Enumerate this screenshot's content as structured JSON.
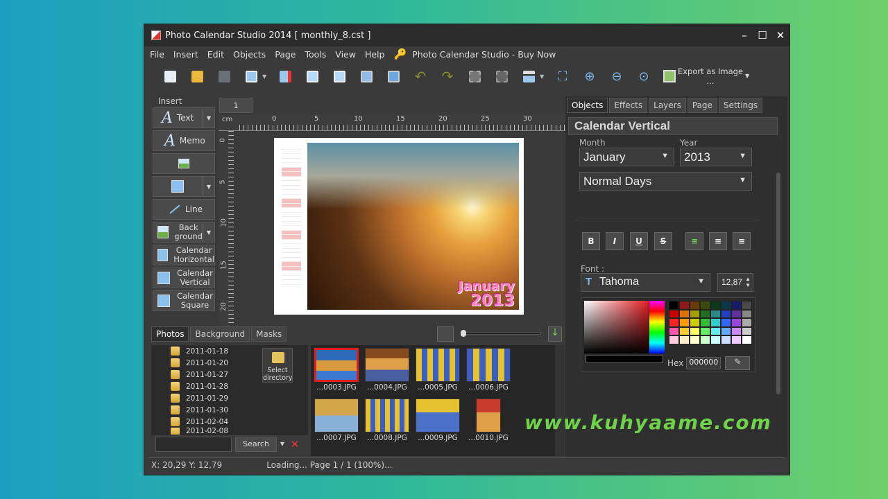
{
  "window": {
    "title": "Photo Calendar Studio 2014 [ monthly_8.cst ]"
  },
  "menu": {
    "items": [
      "File",
      "Insert",
      "Edit",
      "Objects",
      "Page",
      "Tools",
      "View",
      "Help"
    ],
    "buy": "Photo Calendar Studio - Buy Now"
  },
  "toolbar": {
    "export_label": "Export as Image",
    "export_sub": "..."
  },
  "insert": {
    "header": "Insert",
    "text": "Text",
    "memo": "Memo",
    "line": "Line",
    "background": "Back\nground",
    "cal_h": "Calendar\nHorizontal",
    "cal_v": "Calendar\nVertical",
    "cal_s": "Calendar\nSquare"
  },
  "canvas": {
    "page_tab": "1",
    "ruler_unit": "cm",
    "h_ticks": [
      "0",
      "5",
      "10",
      "15",
      "20",
      "25",
      "30"
    ],
    "v_ticks": [
      "0",
      "5",
      "10",
      "15",
      "20"
    ],
    "caption_month": "January",
    "caption_year": "2013"
  },
  "bottom": {
    "tabs": [
      "Photos",
      "Background",
      "Masks"
    ],
    "folders": [
      "2011-01-18",
      "2011-01-20",
      "2011-01-27",
      "2011-01-28",
      "2011-01-29",
      "2011-01-30",
      "2011-02-04",
      "2011-02-08"
    ],
    "select_dir": "Select\ndirectory",
    "search_button": "Search",
    "thumbs": [
      "...0003.JPG",
      "...0004.JPG",
      "...0005.JPG",
      "...0006.JPG",
      "...0007.JPG",
      "...0008.JPG",
      "...0009.JPG",
      "...0010.JPG"
    ]
  },
  "right": {
    "tabs": [
      "Objects",
      "Effects",
      "Layers",
      "Page",
      "Settings"
    ],
    "title": "Calendar Vertical",
    "month_label": "Month",
    "month_value": "January",
    "year_label": "Year",
    "year_value": "2013",
    "days_value": "Normal Days",
    "font_label": "Font :",
    "font_value": "Tahoma",
    "font_size": "12,87",
    "hex_label": "Hex",
    "hex_value": "000000",
    "fmt": [
      "B",
      "I",
      "U",
      "S"
    ]
  },
  "status": {
    "coords": "X: 20,29 Y: 12,79",
    "loading": "Loading... Page 1 / 1 (100%)..."
  },
  "watermark": "www.kuhyaame.com"
}
